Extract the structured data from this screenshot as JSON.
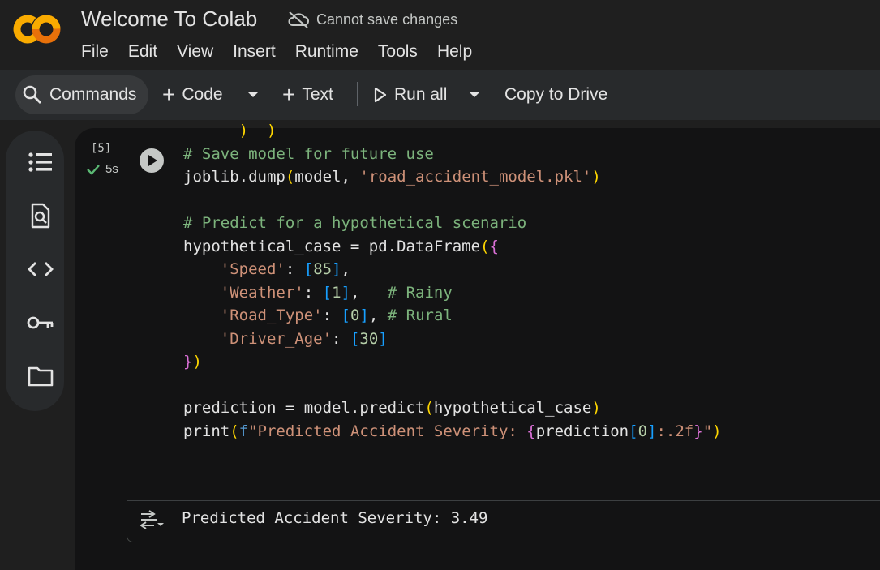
{
  "app": {
    "logo_text": "CO",
    "title": "Welcome To Colab",
    "save_status": "Cannot save changes"
  },
  "menu": [
    "File",
    "Edit",
    "View",
    "Insert",
    "Runtime",
    "Tools",
    "Help"
  ],
  "toolbar": {
    "commands": "Commands",
    "code": "Code",
    "text": "Text",
    "run_all": "Run all",
    "copy_to_drive": "Copy to Drive"
  },
  "sidebar": {
    "icons": [
      "table-of-contents-icon",
      "find-replace-icon",
      "code-snippets-icon",
      "secrets-key-icon",
      "files-folder-icon"
    ]
  },
  "cell": {
    "execution_count": "[5]",
    "execution_time": "5s",
    "code_lines": [
      "# Save model for future use",
      "joblib.dump(model, 'road_accident_model.pkl')",
      "",
      "# Predict for a hypothetical scenario",
      "hypothetical_case = pd.DataFrame({",
      "    'Speed': [85],",
      "    'Weather': [1],   # Rainy",
      "    'Road_Type': [0], # Rural",
      "    'Driver_Age': [30]",
      "})",
      "",
      "prediction = model.predict(hypothetical_case)",
      "print(f\"Predicted Accident Severity: {prediction[0]:.2f}\")"
    ],
    "output": "Predicted Accident Severity: 3.49"
  },
  "colors": {
    "background": "#1f1f1f",
    "toolbar": "#282a2c",
    "notebook": "#131314",
    "comment": "#7cb37c",
    "string": "#ce9178",
    "number": "#b5cea8",
    "logo_orange": "#f9ab00",
    "logo_deep_orange": "#e8710a"
  }
}
